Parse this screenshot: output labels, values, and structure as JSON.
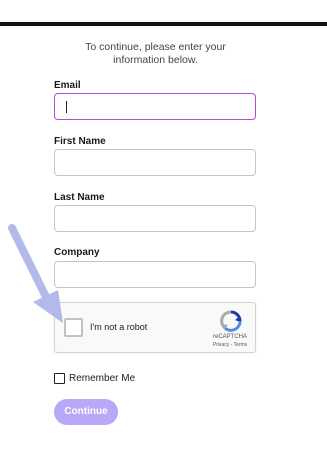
{
  "intro": {
    "line1": "To continue, please enter your",
    "line2": "information below."
  },
  "fields": {
    "email_label": "Email",
    "first_name_label": "First Name",
    "last_name_label": "Last Name",
    "company_label": "Company"
  },
  "recaptcha": {
    "checkbox_label": "I'm not a robot",
    "brand": "reCAPTCHA",
    "links": "Privacy - Terms"
  },
  "remember": {
    "label": "Remember Me"
  },
  "actions": {
    "continue_label": "Continue"
  },
  "colors": {
    "focus_border": "#b44bd6",
    "button": "#b9a8f5",
    "arrow": "#b3b9ea"
  },
  "icons": {
    "recaptcha_logo": "recaptcha-logo-icon",
    "annotation_arrow": "arrow-annotation-icon"
  }
}
